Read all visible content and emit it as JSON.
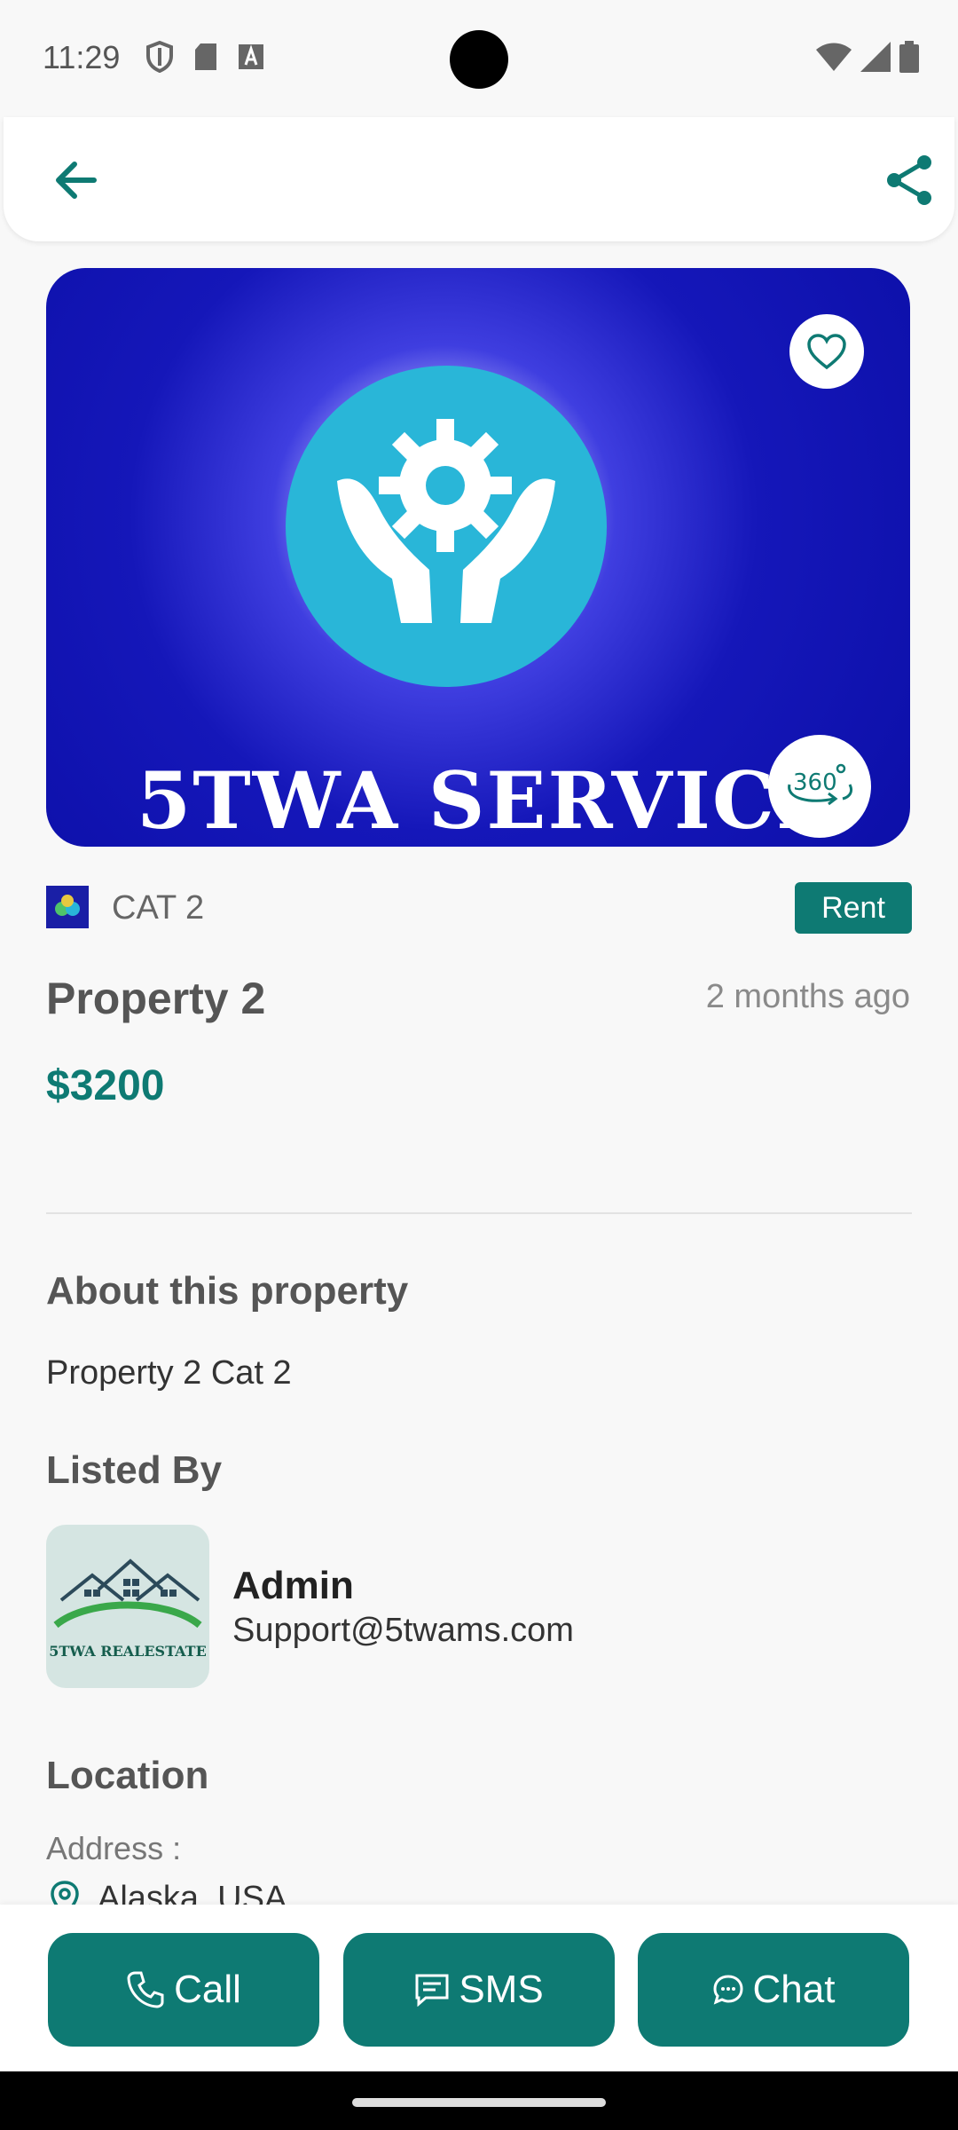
{
  "status_bar": {
    "time": "11:29"
  },
  "header": {
    "back_icon": "arrow-left-icon",
    "share_icon": "share-icon"
  },
  "banner": {
    "text": "5TWA SERVICE",
    "favorite_icon": "heart-outline-icon",
    "view360_icon": "view-360-icon"
  },
  "category": {
    "name": "CAT 2",
    "badge": "Rent"
  },
  "property": {
    "title": "Property 2",
    "posted": "2 months ago",
    "price": "$3200"
  },
  "about": {
    "heading": "About this property",
    "text": "Property 2 Cat 2"
  },
  "listed_by": {
    "heading": "Listed By",
    "name": "Admin",
    "email": "Support@5twams.com",
    "logo_text": "5TWA REALESTATE"
  },
  "location": {
    "heading": "Location",
    "address_label": "Address :",
    "address": "Alaska, USA"
  },
  "actions": {
    "call": "Call",
    "sms": "SMS",
    "chat": "Chat"
  },
  "colors": {
    "accent": "#0e7a73",
    "banner_blue": "#1517b9",
    "banner_circle": "#29b6d8"
  }
}
